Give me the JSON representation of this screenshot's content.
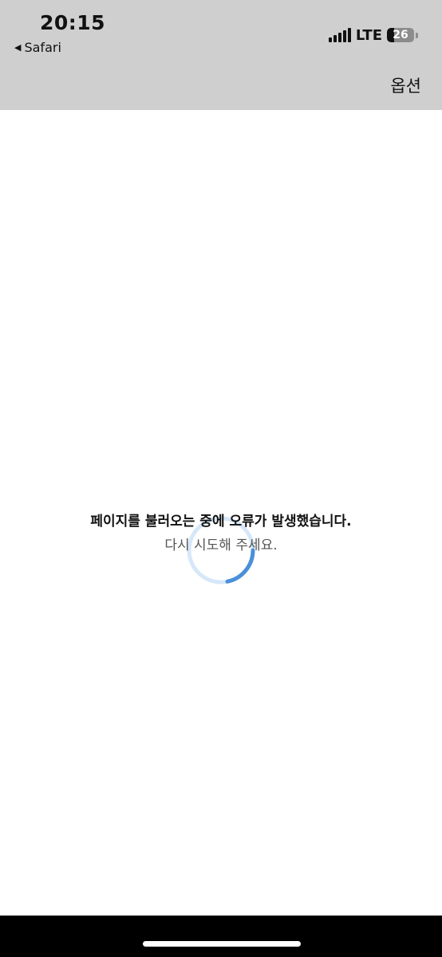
{
  "status_bar": {
    "time": "20:15",
    "back_app_label": "Safari",
    "network": "LTE",
    "battery_level": 26,
    "battery_text": "26",
    "signal_icon": "cellular-signal-icon",
    "back_icon": "back-triangle-icon"
  },
  "nav": {
    "options_label": "옵션"
  },
  "content": {
    "error_title": "페이지를 불러오는 중에 오류가 발생했습니다.",
    "error_subtitle": "다시 시도해 주세요.",
    "spinner_icon": "loading-spinner-icon"
  },
  "colors": {
    "header_bg": "#cfcfcf",
    "spinner_track": "#d6e7f8",
    "spinner_accent": "#4a90d9"
  }
}
